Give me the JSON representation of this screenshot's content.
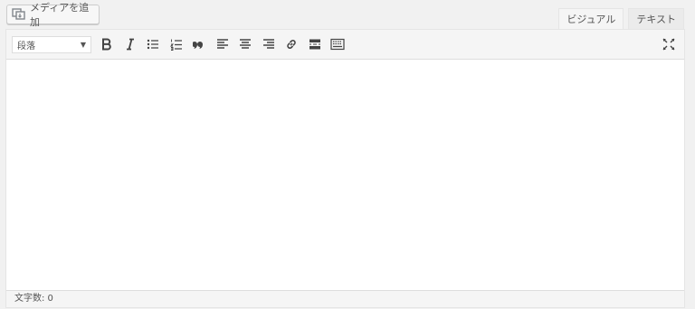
{
  "media_button": {
    "label": "メディアを追加",
    "icon": "add-media-icon"
  },
  "tabs": [
    {
      "label": "ビジュアル",
      "active": true
    },
    {
      "label": "テキスト",
      "active": false
    }
  ],
  "toolbar": {
    "format_select": {
      "value": "段落"
    },
    "buttons": [
      {
        "name": "bold-icon"
      },
      {
        "name": "italic-icon"
      },
      {
        "name": "bulleted-list-icon"
      },
      {
        "name": "numbered-list-icon"
      },
      {
        "name": "blockquote-icon"
      },
      {
        "name": "align-left-icon"
      },
      {
        "name": "align-center-icon"
      },
      {
        "name": "align-right-icon"
      },
      {
        "name": "insert-link-icon"
      },
      {
        "name": "read-more-tag-icon"
      },
      {
        "name": "toolbar-toggle-icon"
      },
      {
        "name": "distraction-free-icon"
      }
    ]
  },
  "editor": {
    "content": ""
  },
  "statusbar": {
    "word_count": "文字数: 0"
  }
}
